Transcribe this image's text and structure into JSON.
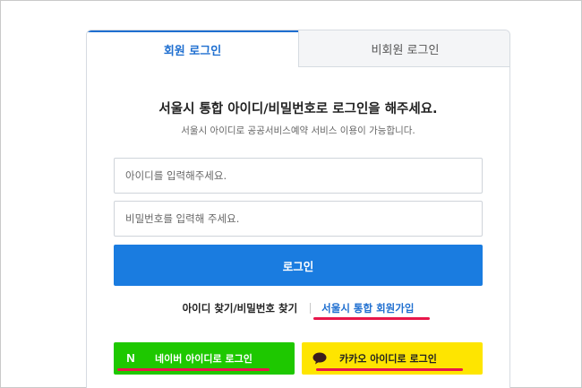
{
  "tabs": {
    "member": "회원 로그인",
    "guest": "비회원 로그인"
  },
  "headline": "서울시 통합 아이디/비밀번호로 로그인을 해주세요.",
  "subline": "서울시 아이디로 공공서비스예약 서비스 이용이 가능합니다.",
  "form": {
    "id_placeholder": "아이디를 입력해주세요.",
    "pw_placeholder": "비밀번호를 입력해 주세요.",
    "login_label": "로그인"
  },
  "links": {
    "find": "아이디 찾기/비밀번호 찾기",
    "join": "서울시 통합 회원가입"
  },
  "social": {
    "naver_label": "네이버 아이디로 로그인",
    "naver_logo": "N",
    "kakao_label": "카카오 아이디로 로그인"
  },
  "colors": {
    "accent": "#1a7ce0",
    "naver": "#1ec800",
    "kakao": "#fee500",
    "highlight": "#e8164b"
  }
}
